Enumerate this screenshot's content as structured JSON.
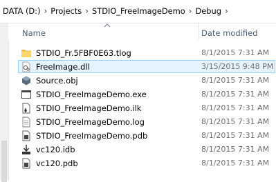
{
  "breadcrumb": [
    {
      "label": "DATA (D:)"
    },
    {
      "label": "Projects"
    },
    {
      "label": "STDIO_FreeImageDemo"
    },
    {
      "label": "Debug"
    }
  ],
  "columns": {
    "name": "Name",
    "date_modified": "Date modified"
  },
  "files": [
    {
      "name": "STDIO_Fr.5FBF0E63.tlog",
      "date": "8/1/2015 7:31 AM",
      "icon": "folder-icon"
    },
    {
      "name": "FreeImage.dll",
      "date": "3/15/2015 9:48 PM",
      "icon": "dll-file-icon",
      "selected": true
    },
    {
      "name": "Source.obj",
      "date": "8/1/2015 7:31 AM",
      "icon": "obj-file-icon"
    },
    {
      "name": "STDIO_FreeImageDemo.exe",
      "date": "8/1/2015 7:31 AM",
      "icon": "exe-file-icon"
    },
    {
      "name": "STDIO_FreeImageDemo.ilk",
      "date": "8/1/2015 7:31 AM",
      "icon": "ilk-file-icon"
    },
    {
      "name": "STDIO_FreeImageDemo.log",
      "date": "8/1/2015 7:31 AM",
      "icon": "text-file-icon"
    },
    {
      "name": "STDIO_FreeImageDemo.pdb",
      "date": "8/1/2015 7:31 AM",
      "icon": "pdb-file-icon"
    },
    {
      "name": "vc120.idb",
      "date": "8/1/2015 7:31 AM",
      "icon": "idb-file-icon"
    },
    {
      "name": "vc120.pdb",
      "date": "8/1/2015 7:31 AM",
      "icon": "pdb-file-icon"
    }
  ]
}
